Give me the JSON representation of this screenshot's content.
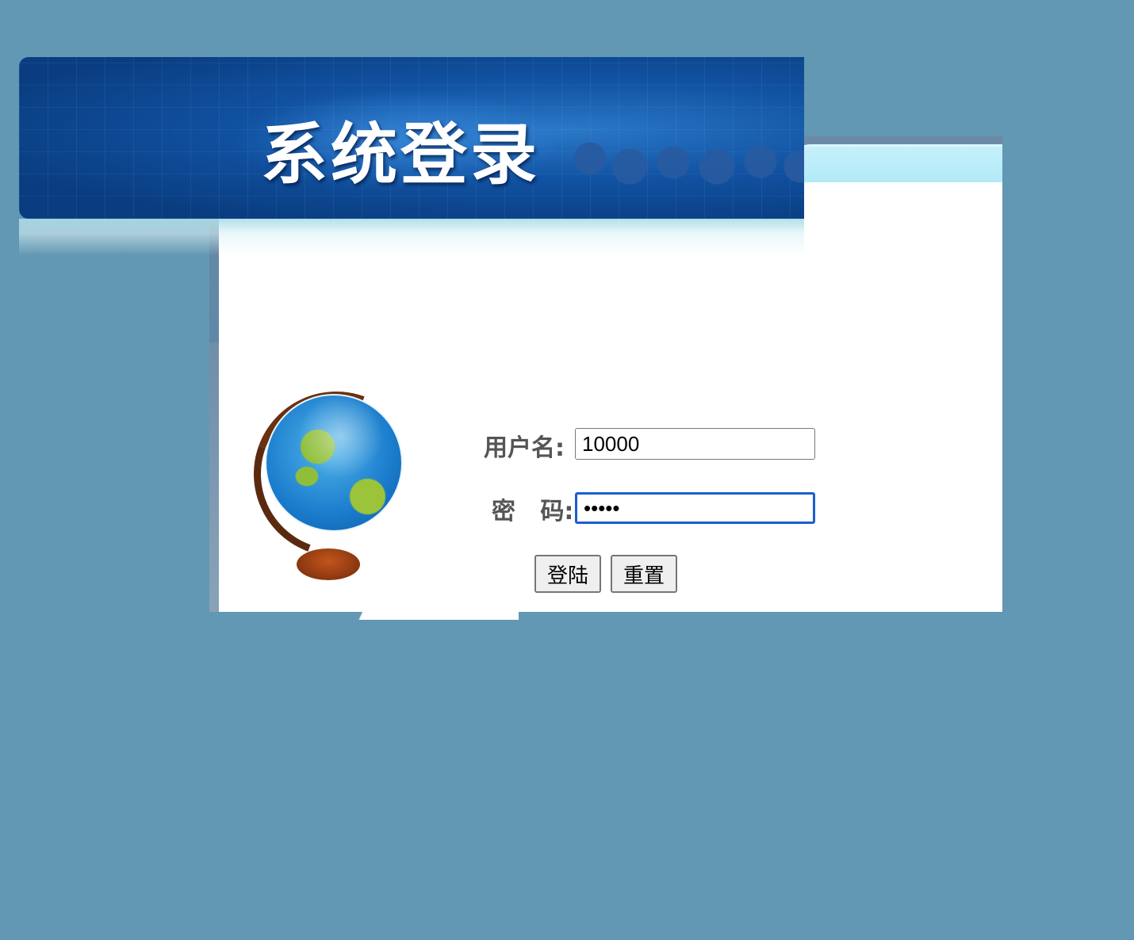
{
  "header": {
    "title": "系统登录"
  },
  "form": {
    "username_label": "用户名:",
    "username_value": "10000",
    "password_label": "密   码:",
    "password_value": "•••••"
  },
  "buttons": {
    "login": "登陆",
    "reset": "重置"
  },
  "colors": {
    "page_background": "#6298b3",
    "banner": "#0d4890",
    "focus_border": "#1a5fcc"
  },
  "icons": [
    "globe-icon"
  ]
}
